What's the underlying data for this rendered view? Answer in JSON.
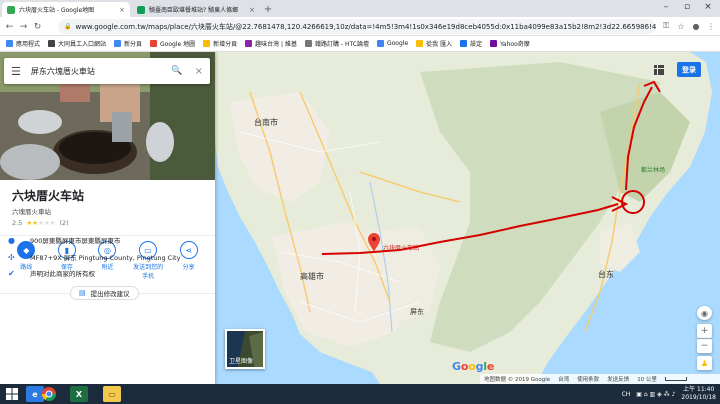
{
  "tabs": [
    {
      "label": "六块厝火车站 - Google地图",
      "active": true,
      "fav_color": "#34a853"
    },
    {
      "label": "騎臺南臣歐堪餐堆站? 騎東人條鄉",
      "active": false,
      "fav_color": "#0f9d58"
    }
  ],
  "url": "www.google.com.tw/maps/place/六块厝火车站/@22.7681478,120.4266619,10z/data=!4m5!3m4!1s0x346e19d8ceb4055d:0x11ba4099e83a15b2!8m2!3d22.665986!4d1...",
  "bookmarks": [
    {
      "label": "應用程式",
      "color": "#4285f4"
    },
    {
      "label": "大同員工入口網站",
      "color": "#444"
    },
    {
      "label": "新分頁",
      "color": "#4285f4"
    },
    {
      "label": "Google 地圖",
      "color": "#ea4335"
    },
    {
      "label": "新增分頁",
      "color": "#fbbc04"
    },
    {
      "label": "趣味台灣 | 維基",
      "color": "#8e24aa"
    },
    {
      "label": "鐵路訂購 - HTC論壇",
      "color": "#777"
    },
    {
      "label": "Google",
      "color": "#4285f4"
    },
    {
      "label": "從我 匯入",
      "color": "#fbbc04"
    },
    {
      "label": "設定",
      "color": "#1a73e8"
    },
    {
      "label": "Yahoo奇摩",
      "color": "#720e9e"
    }
  ],
  "search": {
    "query": "屏东六塊厝火車站"
  },
  "place": {
    "title": "六块厝火车站",
    "subtitle": "六塊厝火車站",
    "rating": "2.5",
    "reviews": "(2)",
    "stars_full": 2,
    "stars_total": 5
  },
  "actions": [
    {
      "label": "路线",
      "icon": "◆"
    },
    {
      "label": "保存",
      "icon": "▮"
    },
    {
      "label": "附近",
      "icon": "◎"
    },
    {
      "label": "发送到您的手机",
      "icon": "▭"
    },
    {
      "label": "分享",
      "icon": "⋖"
    }
  ],
  "details": [
    {
      "icon": "●",
      "text": "900屏東縣屏東市屏東縣屏東市"
    },
    {
      "icon": "✣",
      "text": "MF87+9X 屏东 Pingtung County, Pingtung City"
    },
    {
      "icon": "✔",
      "text": "声明对此商家的所有权"
    }
  ],
  "suggest_label": "提出修改建议",
  "map": {
    "labels": {
      "tainan": "台南市",
      "kaohsiung": "高雄市",
      "pingtung": "屏东",
      "taitung": "台东",
      "dulan": "都兰林场",
      "station": "六块厝火车站"
    },
    "login_label": "登录",
    "satellite_label": "卫星图像",
    "google_logo": [
      "G",
      "o",
      "o",
      "g",
      "l",
      "e"
    ],
    "logo_colors": [
      "#4285f4",
      "#ea4335",
      "#fbbc04",
      "#4285f4",
      "#34a853",
      "#ea4335"
    ],
    "attribution": [
      "地图数据 © 2019 Google",
      "台湾",
      "使用条款",
      "发送反馈",
      "10 公里"
    ]
  },
  "taskbar": {
    "lang": "CH",
    "time": "上午 11:40",
    "date": "2019/10/18"
  },
  "colors": {
    "accent": "#1a73e8",
    "route": "#d50000",
    "water": "#aadaff",
    "land": "#e8eee0",
    "urban": "#f3efe6"
  }
}
